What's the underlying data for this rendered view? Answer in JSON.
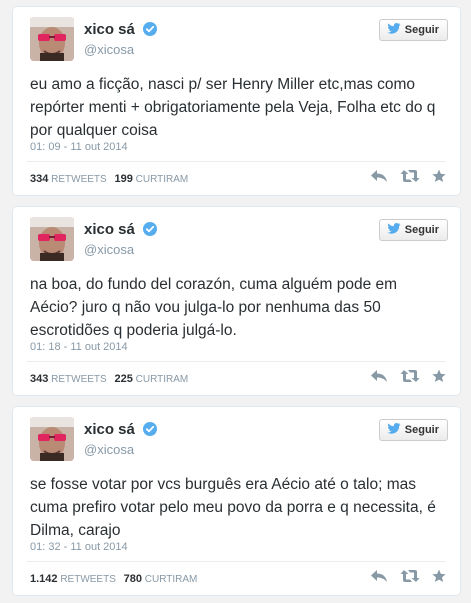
{
  "follow_label": "Seguir",
  "colors": {
    "verified": "#55acee",
    "bird": "#55acee",
    "action_icon": "#8899a6",
    "name": "#292f33",
    "muted": "#8899a6"
  },
  "tweets": [
    {
      "display_name": "xico sá",
      "handle": "@xicosa",
      "text": "eu amo a ficção, nasci p/ ser Henry Miller etc,mas como repórter menti + obrigatoriamente pela Veja, Folha etc do q por qualquer coisa",
      "timestamp": "01: 09 - 11 out 2014",
      "retweets": "334",
      "retweets_label": "RETWEETS",
      "likes": "199",
      "likes_label": "CURTIRAM"
    },
    {
      "display_name": "xico sá",
      "handle": "@xicosa",
      "text": "na boa, do fundo del corazón, cuma alguém pode em Aécio? juro q não vou julga-lo por nenhuma das 50 escrotidões q poderia julgá-lo.",
      "timestamp": "01: 18 - 11 out 2014",
      "retweets": "343",
      "retweets_label": "RETWEETS",
      "likes": "225",
      "likes_label": "CURTIRAM"
    },
    {
      "display_name": "xico sá",
      "handle": "@xicosa",
      "text": "se fosse votar por vcs burguês era Aécio até o talo; mas cuma prefiro votar pelo meu povo da porra e q necessita, é Dilma, carajo",
      "timestamp": "01: 32 - 11 out 2014",
      "retweets": "1.142",
      "retweets_label": "RETWEETS",
      "likes": "780",
      "likes_label": "CURTIRAM"
    }
  ]
}
